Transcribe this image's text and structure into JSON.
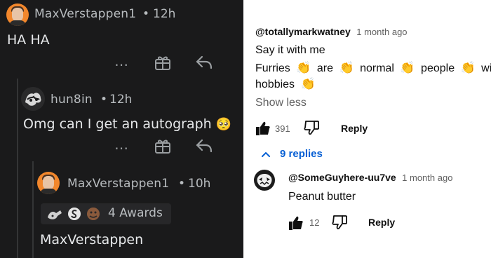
{
  "left_panel": {
    "comment1": {
      "username": "MaxVerstappen1",
      "separator": "•",
      "time": "12h",
      "text": "HA HA"
    },
    "comment2": {
      "username": "hun8in",
      "separator": "•",
      "time": "12h",
      "text": "Omg can I get an autograph",
      "emoji": "🥺"
    },
    "comment3": {
      "username": "MaxVerstappen1",
      "separator": "•",
      "time": "10h",
      "awards_count": "4 Awards",
      "text": "MaxVerstappen"
    },
    "icons": {
      "more": "more-horizontal-icon",
      "award": "gift-award-icon",
      "reply": "reply-arrow-icon"
    },
    "colors": {
      "background": "#1a1a1b",
      "text": "#d7dadc",
      "avatar": "#f2872c"
    }
  },
  "right_panel": {
    "comment1": {
      "username": "@totallymarkwatney",
      "time": "1 month ago",
      "line1": "Say it with me",
      "words": [
        "Furries",
        "are",
        "normal",
        "people",
        "with"
      ],
      "word_last": "hobbies",
      "clap_emoji": "👏",
      "show_less": "Show less",
      "likes": "391",
      "reply_label": "Reply",
      "replies_toggle": "9 replies"
    },
    "comment2": {
      "username": "@SomeGuyhere-uu7ve",
      "time": "1 month ago",
      "text": "Peanut butter",
      "likes": "12",
      "reply_label": "Reply"
    },
    "colors": {
      "background": "#ffffff",
      "link": "#065fd4",
      "text": "#0f0f0f",
      "muted": "#606060"
    }
  }
}
